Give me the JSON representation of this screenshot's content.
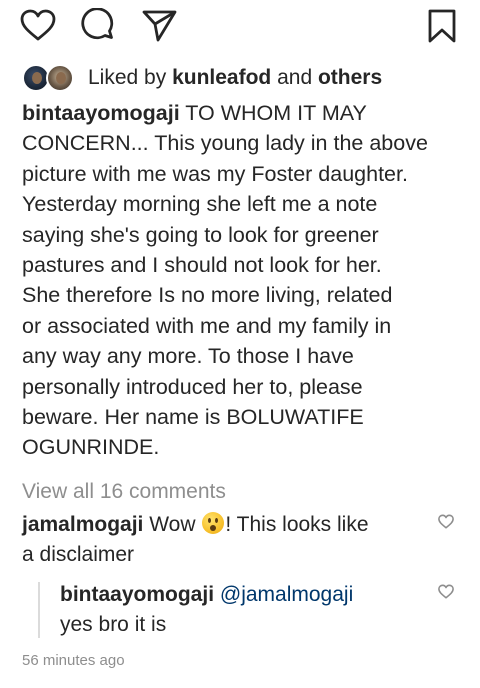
{
  "actions": {
    "icons": [
      "heart-icon",
      "comment-icon",
      "share-icon",
      "bookmark-icon"
    ]
  },
  "likes": {
    "prefix": "Liked by ",
    "user": "kunleafod",
    "middle": " and ",
    "others": "others"
  },
  "caption": {
    "username": "bintaayomogaji",
    "lines": [
      " TO WHOM IT MAY",
      "CONCERN... This young lady in the above",
      "picture with me was my Foster daughter.",
      "Yesterday morning she left me a note",
      "saying she's going to look for greener",
      "pastures and I should not look for her.",
      "She therefore Is no more living, related",
      "or associated with me and my family in",
      "any way any more. To those I have",
      "personally introduced her to, please",
      "beware. Her name is BOLUWATIFE",
      "OGUNRINDE."
    ]
  },
  "view_all_comments": "View all 16 comments",
  "comments": [
    {
      "username": "jamalmogaji",
      "text_before_emoji": " Wow ",
      "emoji": "astonished-face",
      "text_after_emoji": "! This looks like",
      "line2": "a disclaimer"
    }
  ],
  "replies": [
    {
      "username": "bintaayomogaji",
      "mention": "@jamalmogaji",
      "text": "yes bro it is"
    }
  ],
  "timestamp": "56 minutes ago"
}
